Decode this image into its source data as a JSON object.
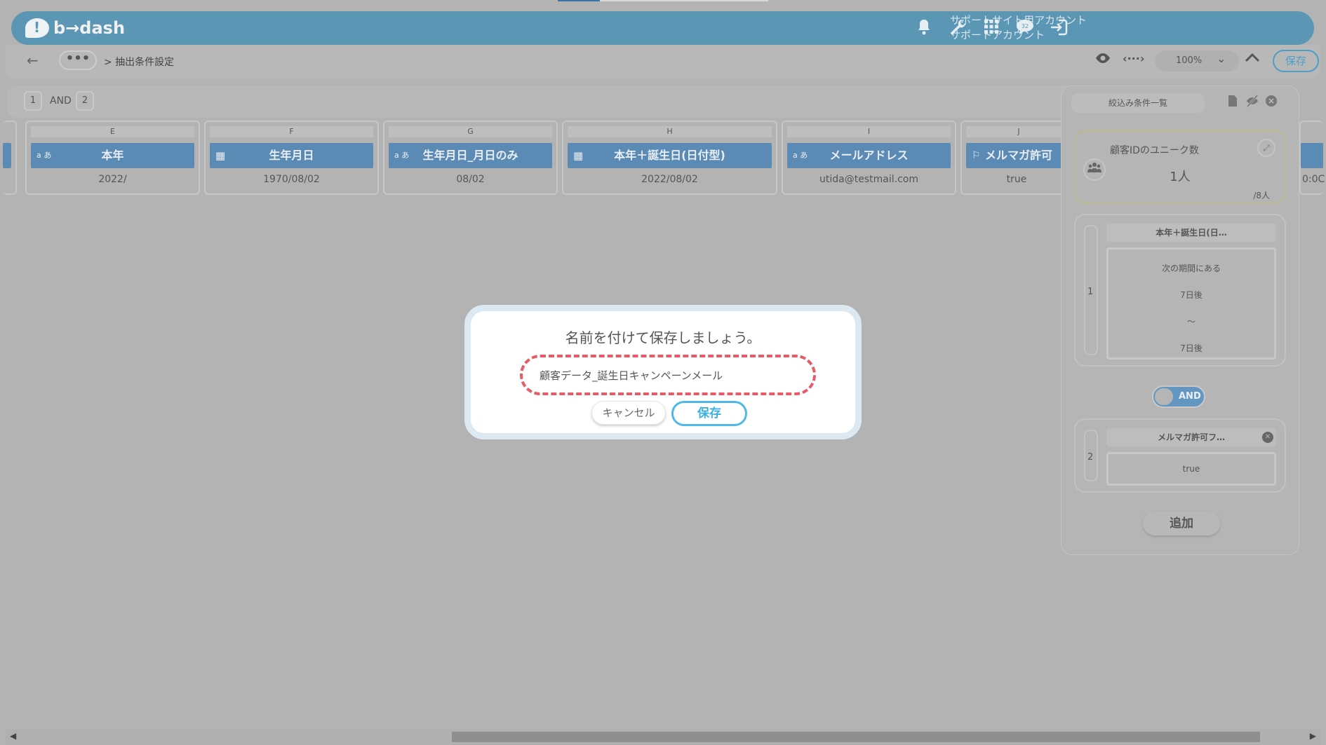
{
  "header": {
    "logo_text": "b→dash",
    "account_line1": "サポートサイト用アカウント",
    "account_line2": "サポートアカウント",
    "icons": [
      "bell-icon",
      "wrench-icon",
      "grid-icon",
      "chat-icon",
      "logout-icon"
    ],
    "chat_badge": "32"
  },
  "toolbar": {
    "back_glyph": "←",
    "more_glyph": "•••",
    "breadcrumb": "> 抽出条件設定",
    "zoom": "100%",
    "save_label": "保存"
  },
  "condition_bar": {
    "left": "1",
    "op": "AND",
    "right": "2"
  },
  "columns": [
    {
      "letter": "E",
      "name": "本年",
      "icon": "a-icon",
      "value": "2022/"
    },
    {
      "letter": "F",
      "name": "生年月日",
      "icon": "calendar-icon",
      "value": "1970/08/02"
    },
    {
      "letter": "G",
      "name": "生年月日_月日のみ",
      "icon": "a-icon",
      "value": "08/02"
    },
    {
      "letter": "H",
      "name": "本年＋誕生日(日付型)",
      "icon": "calendar-icon",
      "value": "2022/08/02"
    },
    {
      "letter": "I",
      "name": "メールアドレス",
      "icon": "a-icon",
      "value": "utida@testmail.com"
    },
    {
      "letter": "J",
      "name": "メルマガ許可",
      "icon": "flag-icon",
      "value": "true"
    }
  ],
  "panel": {
    "tab_label": "絞込み条件一覧",
    "unique": {
      "title": "顧客IDのユニーク数",
      "value": "1人",
      "total": "/8人"
    },
    "cond1": {
      "num": "1",
      "title": "本年＋誕生日(日…",
      "line1": "次の期間にある",
      "line2": "7日後",
      "line3": "～",
      "line4": "7日後"
    },
    "toggle_label": "AND",
    "cond2": {
      "num": "2",
      "title": "メルマガ許可フ…",
      "value": "true"
    },
    "add_label": "追加"
  },
  "modal": {
    "title": "名前を付けて保存しましょう。",
    "input_value": "顧客データ_誕生日キャンペーンメール",
    "cancel_label": "キャンセル",
    "save_label": "保存"
  }
}
